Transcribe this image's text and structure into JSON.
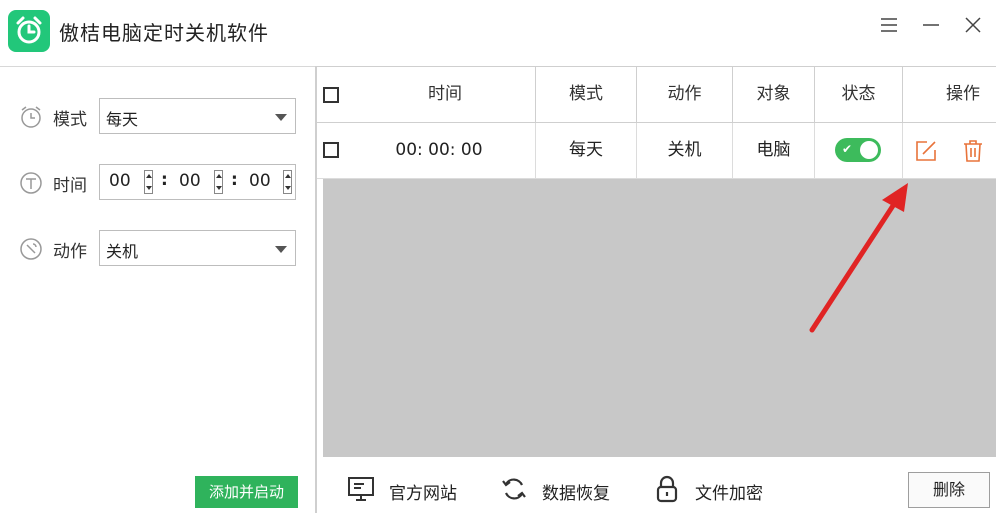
{
  "titlebar": {
    "title": "傲桔电脑定时关机软件",
    "icons": [
      "alarm-clock-icon",
      "menu-icon",
      "minimize-icon",
      "close-icon"
    ]
  },
  "left": {
    "mode": {
      "label": "模式",
      "value": "每天"
    },
    "time": {
      "label": "时间",
      "hour": "00",
      "minute": "00",
      "second": "00"
    },
    "action": {
      "label": "动作",
      "value": "关机"
    },
    "add_button": "添加并启动"
  },
  "table": {
    "headers": [
      "时间",
      "模式",
      "动作",
      "对象",
      "状态",
      "操作"
    ],
    "rows": [
      {
        "time": "00: 00: 00",
        "mode": "每天",
        "action": "关机",
        "target": "电脑",
        "enabled": true
      }
    ]
  },
  "bottom": {
    "website": "官方网站",
    "restore": "数据恢复",
    "encrypt": "文件加密",
    "delete": "删除"
  },
  "colors": {
    "accent": "#2fb35c",
    "icon_orange": "#e8733a",
    "arrow_red": "#e02424"
  }
}
